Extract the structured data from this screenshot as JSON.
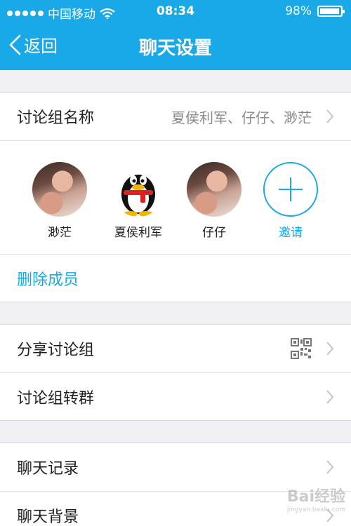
{
  "status_bar": {
    "carrier": "中国移动",
    "time": "08:34",
    "battery": "98%"
  },
  "nav": {
    "back_label": "返回",
    "title": "聊天设置"
  },
  "group_name": {
    "label": "讨论组名称",
    "value": "夏侯利军、仔仔、渺茫"
  },
  "members": [
    {
      "name": "渺茫"
    },
    {
      "name": "夏侯利军"
    },
    {
      "name": "仔仔"
    }
  ],
  "invite_label": "邀请",
  "delete_members_label": "删除成员",
  "share_group": {
    "label": "分享讨论组"
  },
  "convert_group": {
    "label": "讨论组转群"
  },
  "chat_history": {
    "label": "聊天记录"
  },
  "chat_background": {
    "label": "聊天背景"
  },
  "watermark": {
    "text": "Bai经验",
    "url": "jingyan.baidu.com"
  },
  "colors": {
    "accent": "#19a8e8",
    "background": "#efeff4"
  }
}
